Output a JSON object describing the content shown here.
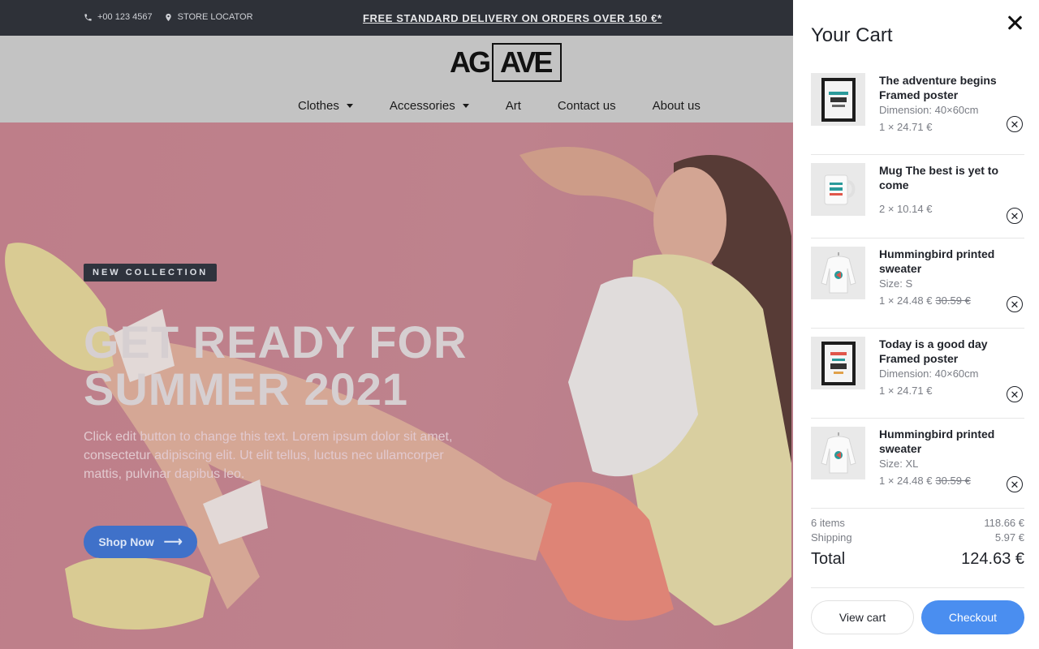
{
  "topbar": {
    "phone": "+00 123 4567",
    "store_locator": "STORE LOCATOR",
    "promo": "FREE STANDARD DELIVERY ON ORDERS OVER 150 €*"
  },
  "header": {
    "logo_left": "AG",
    "logo_right": "AVE",
    "nav": [
      {
        "label": "Clothes"
      },
      {
        "label": "Accessories"
      },
      {
        "label": "Art"
      },
      {
        "label": "Contact us"
      },
      {
        "label": "About us"
      }
    ]
  },
  "hero": {
    "badge": "NEW COLLECTION",
    "headline_line1": "GET READY FOR",
    "headline_line2": "SUMMER 2021",
    "copy": "Click edit button to change this text. Lorem ipsum dolor sit amet, consectetur adipiscing elit. Ut elit tellus, luctus nec ullamcorper mattis, pulvinar dapibus leo.",
    "button": "Shop Now"
  },
  "cart": {
    "title": "Your Cart",
    "items": [
      {
        "name": "The adventure begins Framed poster",
        "attr": "Dimension: 40×60cm",
        "price": "1 × 24.71 €",
        "old_price": ""
      },
      {
        "name": "Mug The best is yet to come",
        "attr": "",
        "price": "2 × 10.14 €",
        "old_price": ""
      },
      {
        "name": "Hummingbird printed sweater",
        "attr": "Size: S",
        "price": "1 × 24.48 €",
        "old_price": "30.59 €"
      },
      {
        "name": "Today is a good day Framed poster",
        "attr": "Dimension: 40×60cm",
        "price": "1 × 24.71 €",
        "old_price": ""
      },
      {
        "name": "Hummingbird printed sweater",
        "attr": "Size: XL",
        "price": "1 × 24.48 €",
        "old_price": "30.59 €"
      }
    ],
    "summary": {
      "items_label": "6 items",
      "items_value": "118.66 €",
      "shipping_label": "Shipping",
      "shipping_value": "5.97 €",
      "total_label": "Total",
      "total_value": "124.63 €"
    },
    "view_cart": "View cart",
    "checkout": "Checkout"
  }
}
